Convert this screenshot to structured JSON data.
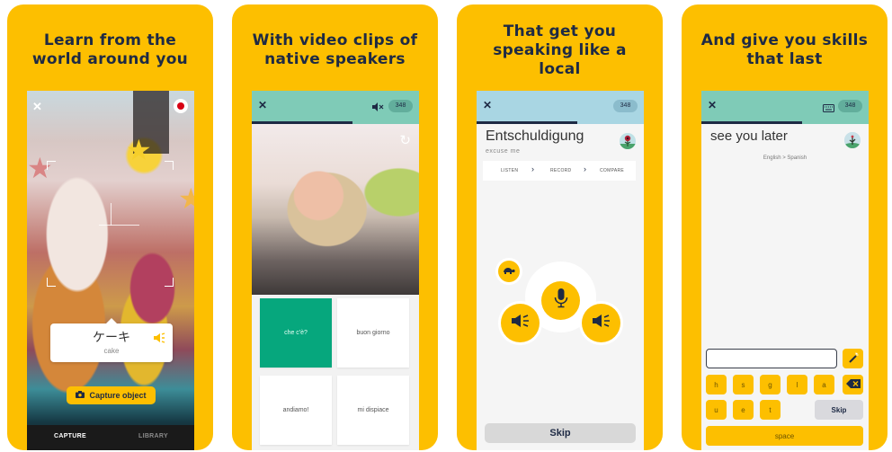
{
  "colors": {
    "brand_yellow": "#fdbf00",
    "navy": "#1e2a44",
    "teal_header": "#7fcbb7",
    "blue_header": "#a9d6e3",
    "tile_selected": "#06a77d",
    "record_red": "#d70014"
  },
  "panels": [
    {
      "headline_lines": [
        "Learn from the",
        "world around you"
      ],
      "screen": {
        "close_icon": "close-icon",
        "record_icon": "record-icon",
        "label": {
          "word": "ケーキ",
          "translation": "cake",
          "icon": "speaker-icon"
        },
        "capture_button": {
          "icon": "camera-icon",
          "label": "Capture object"
        },
        "tabs": [
          {
            "label": "CAPTURE",
            "active": true
          },
          {
            "label": "LIBRARY",
            "active": false
          }
        ]
      }
    },
    {
      "headline_lines": [
        "With video clips of",
        "native speakers"
      ],
      "screen": {
        "close_icon": "close-icon",
        "mute_icon": "mute-icon",
        "points": "348",
        "progress": 0.6,
        "replay_icon": "replay-icon",
        "options": [
          {
            "label": "che c'è?",
            "selected": true
          },
          {
            "label": "buon giorno",
            "selected": false
          },
          {
            "label": "andiamo!",
            "selected": false
          },
          {
            "label": "mi dispiace",
            "selected": false
          }
        ]
      }
    },
    {
      "headline_lines": [
        "That get you",
        "speaking like a",
        "local"
      ],
      "screen": {
        "close_icon": "close-icon",
        "points": "348",
        "progress": 0.6,
        "word": "Entschuldigung",
        "translation": "excuse me",
        "steps": [
          "LISTEN",
          "RECORD",
          "COMPARE"
        ],
        "slow_icon": "turtle-icon",
        "mic_icon": "microphone-icon",
        "speaker_icon": "speaker-icon",
        "skip_label": "Skip"
      }
    },
    {
      "headline_lines": [
        "And give you skills",
        "that last"
      ],
      "screen": {
        "close_icon": "close-icon",
        "keyboard_icon": "keyboard-icon",
        "points": "348",
        "progress": 0.6,
        "phrase": "see you later",
        "direction": "English > Spanish",
        "input_value": "",
        "hint_icon": "magic-wand-icon",
        "backspace_icon": "backspace-icon",
        "keys_row1": [
          "h",
          "s",
          "g",
          "l",
          "a"
        ],
        "keys_row2": [
          "u",
          "e",
          "t"
        ],
        "skip_label": "Skip",
        "space_label": "space"
      }
    }
  ]
}
